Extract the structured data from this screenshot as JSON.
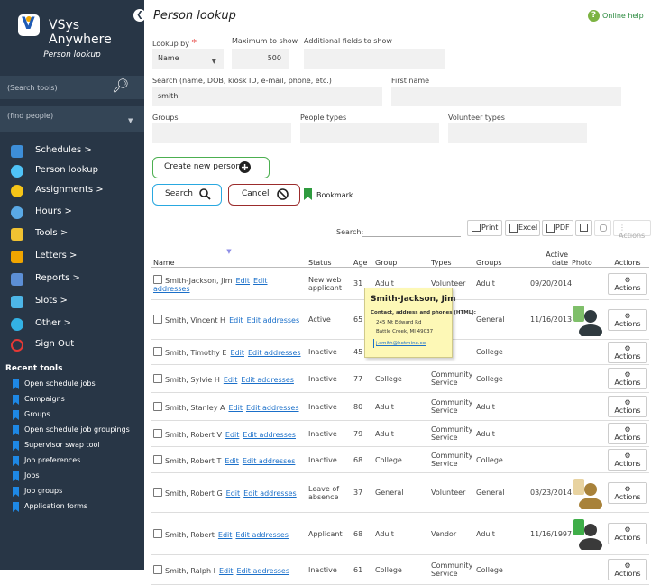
{
  "app": {
    "name": "VSys Anywhere",
    "page_subtitle": "Person lookup"
  },
  "sidebar": {
    "search_placeholder": "(Search tools)",
    "people_placeholder": "(find people)",
    "nav": [
      {
        "label": "Schedules >",
        "icon": "calendar-icon",
        "color": "#3d8ed8"
      },
      {
        "label": "Person lookup",
        "icon": "person-search-icon",
        "color": "#4fc3f7"
      },
      {
        "label": "Assignments >",
        "icon": "assignments-icon",
        "color": "#f5c518"
      },
      {
        "label": "Hours >",
        "icon": "clock-icon",
        "color": "#5aa9e6"
      },
      {
        "label": "Tools >",
        "icon": "tools-icon",
        "color": "#f1c232"
      },
      {
        "label": "Letters >",
        "icon": "letters-icon",
        "color": "#f0a500"
      },
      {
        "label": "Reports >",
        "icon": "reports-icon",
        "color": "#5c8fd6"
      },
      {
        "label": "Slots >",
        "icon": "slots-icon",
        "color": "#4db6e8"
      },
      {
        "label": "Other >",
        "icon": "other-icon",
        "color": "#33b2e5"
      },
      {
        "label": "Sign Out",
        "icon": "sign-out-icon",
        "color": "#e53935"
      }
    ],
    "recent_title": "Recent tools",
    "recent": [
      "Open schedule jobs",
      "Campaigns",
      "Groups",
      "Open schedule job groupings",
      "Supervisor swap tool",
      "Job preferences",
      "Jobs",
      "Job groups",
      "Application forms"
    ]
  },
  "header": {
    "title": "Person lookup",
    "help": "Online help"
  },
  "form": {
    "lookup_by_label": "Lookup by",
    "lookup_by_value": "Name",
    "max_label": "Maximum to show",
    "max_value": "500",
    "additional_label": "Additional fields to show",
    "search_label": "Search (name, DOB, kiosk ID, e-mail, phone, etc.)",
    "search_value": "smith",
    "first_name_label": "First name",
    "groups_label": "Groups",
    "people_types_label": "People types",
    "volunteer_types_label": "Volunteer types"
  },
  "buttons": {
    "create": "Create new person",
    "search": "Search",
    "cancel": "Cancel",
    "bookmark": "Bookmark"
  },
  "toolbar": {
    "search_label": "Search:",
    "print": "Print",
    "excel": "Excel",
    "pdf": "PDF",
    "actions": "Actions"
  },
  "table": {
    "columns": [
      "Name",
      "Status",
      "Age",
      "Group",
      "Types",
      "Groups",
      "Active date",
      "Photo",
      "Actions"
    ],
    "edit_label": "Edit",
    "edit_addresses_label": "Edit addresses",
    "action_label": "Actions",
    "rows": [
      {
        "name": "Smith-Jackson, Jim",
        "status": "New web applicant",
        "age": "31",
        "group": "Adult",
        "types": "Volunteer",
        "groups": "Adult",
        "active_date": "09/20/2014",
        "photo": ""
      },
      {
        "name": "Smith, Vincent H",
        "status": "Active",
        "age": "65",
        "group": "",
        "types": "",
        "groups": "General",
        "active_date": "11/16/2013",
        "photo": "dark-silhouette"
      },
      {
        "name": "Smith, Timothy E",
        "status": "Inactive",
        "age": "45",
        "group": "",
        "types": "",
        "groups": "College",
        "active_date": "",
        "photo": ""
      },
      {
        "name": "Smith, Sylvie H",
        "status": "Inactive",
        "age": "77",
        "group": "College",
        "types": "Community Service",
        "groups": "College",
        "active_date": "",
        "photo": ""
      },
      {
        "name": "Smith, Stanley A",
        "status": "Inactive",
        "age": "80",
        "group": "Adult",
        "types": "Community Service",
        "groups": "Adult",
        "active_date": "",
        "photo": ""
      },
      {
        "name": "Smith, Robert V",
        "status": "Inactive",
        "age": "79",
        "group": "Adult",
        "types": "Community Service",
        "groups": "Adult",
        "active_date": "",
        "photo": ""
      },
      {
        "name": "Smith, Robert T",
        "status": "Inactive",
        "age": "68",
        "group": "College",
        "types": "Community Service",
        "groups": "College",
        "active_date": "",
        "photo": ""
      },
      {
        "name": "Smith, Robert G",
        "status": "Leave of absence",
        "age": "37",
        "group": "General",
        "types": "Volunteer",
        "groups": "General",
        "active_date": "03/23/2014",
        "photo": "gold-silhouette"
      },
      {
        "name": "Smith, Robert",
        "status": "Applicant",
        "age": "68",
        "group": "Adult",
        "types": "Vendor",
        "groups": "Adult",
        "active_date": "11/16/1997",
        "photo": "green-silhouette"
      },
      {
        "name": "Smith, Ralph I",
        "status": "Inactive",
        "age": "61",
        "group": "College",
        "types": "Community Service",
        "groups": "College",
        "active_date": "",
        "photo": ""
      }
    ]
  },
  "tooltip": {
    "name": "Smith-Jackson, Jim",
    "caption": "Contact, address and phones (HTML):",
    "line1": "245 Mt Edward Rd",
    "line2": "Battle Creek, MI 49037",
    "email": "j.smith@hotmine.co"
  }
}
